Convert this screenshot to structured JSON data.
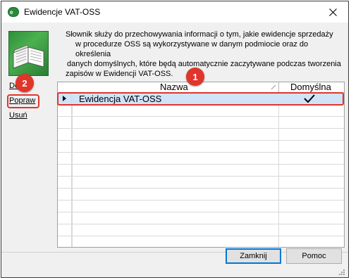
{
  "window": {
    "title": "Ewidencje VAT-OSS",
    "app_icon_text": "e"
  },
  "description": "Słownik służy do przechowywania informacji o tym, jakie ewidencje sprzedaży w procedurze OSS są wykorzystywane w danym podmiocie oraz do określenia danych domyślnych, które będą automatycznie zaczytywane podczas tworzenia zapisów w Ewidencji VAT-OSS.",
  "description_lines": [
    "Słownik służy do przechowywania informacji o tym, jakie ewidencje sprzedaży",
    "w procedurze OSS są wykorzystywane w danym podmiocie oraz do określenia",
    "danych domyślnych, które będą automatycznie zaczytywane podczas tworzenia",
    "zapisów w Ewidencji VAT-OSS."
  ],
  "actions": {
    "add": "Dodaj",
    "edit": "Popraw",
    "delete": "Usuń"
  },
  "grid": {
    "columns": [
      "Nazwa",
      "Domyślna"
    ],
    "rows": [
      {
        "name": "Ewidencja VAT-OSS",
        "default": true
      }
    ]
  },
  "annotations": {
    "badge1": "1",
    "badge2": "2"
  },
  "buttons": {
    "close": "Zamknij",
    "help": "Pomoc"
  },
  "colors": {
    "accent_red": "#e0352b",
    "selection": "#cfe3f9"
  }
}
